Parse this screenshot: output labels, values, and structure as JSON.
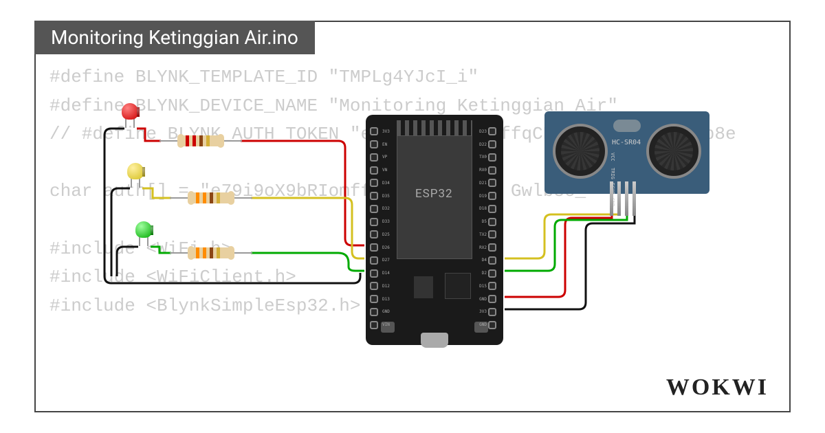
{
  "title": "Monitoring Ketinggian Air.ino",
  "brand": "WOKWI",
  "code_lines": [
    "#define BLYNK_TEMPLATE_ID \"TMPLg4YJcI_i\"",
    "#define BLYNK_DEVICE_NAME \"Monitoring Ketinggian Air\"",
    "// #define BLYNK_AUTH_TOKEN \"e79i9oX9bRIomffqCN           Gwlb8e",
    "",
    "char auth[] = \"e79i9oX9bRIomffqCN          Gwlb8e_\"",
    "",
    "#include <WiFi.h>",
    "#include <WiFiClient.h>",
    "#include <BlynkSimpleEsp32.h>"
  ],
  "components": {
    "mcu": {
      "name": "ESP32",
      "label": "ESP32"
    },
    "ultrasonic": {
      "name": "HC-SR04",
      "label": "HC-SR04",
      "pins": [
        "VCC",
        "TRIG",
        "ECHO",
        "GND"
      ]
    },
    "leds": [
      {
        "color": "red"
      },
      {
        "color": "yellow"
      },
      {
        "color": "green"
      }
    ],
    "resistors": [
      {
        "bands": [
          "brown",
          "black",
          "orange",
          "gold"
        ]
      },
      {
        "bands": [
          "brown",
          "black",
          "orange",
          "gold"
        ]
      },
      {
        "bands": [
          "brown",
          "black",
          "orange",
          "gold"
        ]
      }
    ]
  },
  "wires": [
    {
      "color": "#c00",
      "desc": "led-red anode to ESP32"
    },
    {
      "color": "#d4c020",
      "desc": "led-yellow anode to ESP32"
    },
    {
      "color": "#0a0",
      "desc": "led-green anode to ESP32"
    },
    {
      "color": "#000",
      "desc": "led cathodes to GND"
    },
    {
      "color": "#c00",
      "desc": "HC-SR04 VCC"
    },
    {
      "color": "#d4c020",
      "desc": "HC-SR04 TRIG"
    },
    {
      "color": "#0a0",
      "desc": "HC-SR04 ECHO"
    },
    {
      "color": "#000",
      "desc": "HC-SR04 GND"
    }
  ],
  "pins_left": [
    "3V3",
    "EN",
    "VP",
    "VN",
    "D34",
    "D35",
    "D32",
    "D33",
    "D25",
    "D26",
    "D27",
    "D14",
    "D12",
    "D13",
    "GND",
    "VIN"
  ],
  "pins_right": [
    "D23",
    "D22",
    "TX0",
    "RX0",
    "D21",
    "D19",
    "D18",
    "D5",
    "TX2",
    "RX2",
    "D4",
    "D2",
    "D15",
    "GND",
    "3V3",
    "GND"
  ]
}
